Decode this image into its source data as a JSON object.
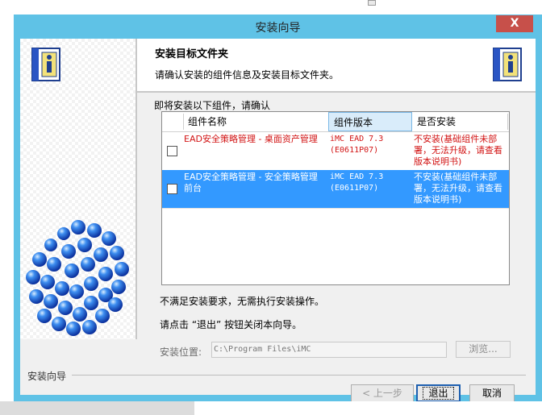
{
  "window": {
    "title": "安装向导",
    "close_glyph": "X"
  },
  "header": {
    "title": "安装目标文件夹",
    "subtitle": "请确认安装的组件信息及安装目标文件夹。"
  },
  "intro": "即将安装以下组件，请确认",
  "table": {
    "columns": [
      "组件名称",
      "组件版本",
      "是否安装"
    ],
    "rows": [
      {
        "checked": false,
        "selected": false,
        "name": "EAD安全策略管理 - 桌面资产管理",
        "version": "iMC EAD 7.3 (E0611P07)",
        "install": "不安装(基础组件未部署，无法升级，请查看版本说明书)"
      },
      {
        "checked": false,
        "selected": true,
        "name": "EAD安全策略管理 - 安全策略管理前台",
        "version": "iMC EAD 7.3 (E0611P07)",
        "install": "不安装(基础组件未部署，无法升级，请查看版本说明书)"
      }
    ]
  },
  "messages": {
    "requirement": "不满足安装要求，无需执行安装操作。",
    "exit_hint": "请点击 “退出” 按钮关闭本向导。"
  },
  "location": {
    "label": "安装位置:",
    "value": "C:\\Program Files\\iMC",
    "browse_label": "浏览..."
  },
  "footer": {
    "group_label": "安装向导",
    "prev_label": "< 上一步",
    "exit_label": "退出",
    "cancel_label": "取消"
  },
  "colors": {
    "title_bar": "#5fc2e6",
    "selection": "#3399ff",
    "warning_text": "#d21414",
    "close_button": "#c7504a"
  },
  "icons": [
    "info-book-icon",
    "molecule-sphere-image",
    "checkbox-icon"
  ]
}
